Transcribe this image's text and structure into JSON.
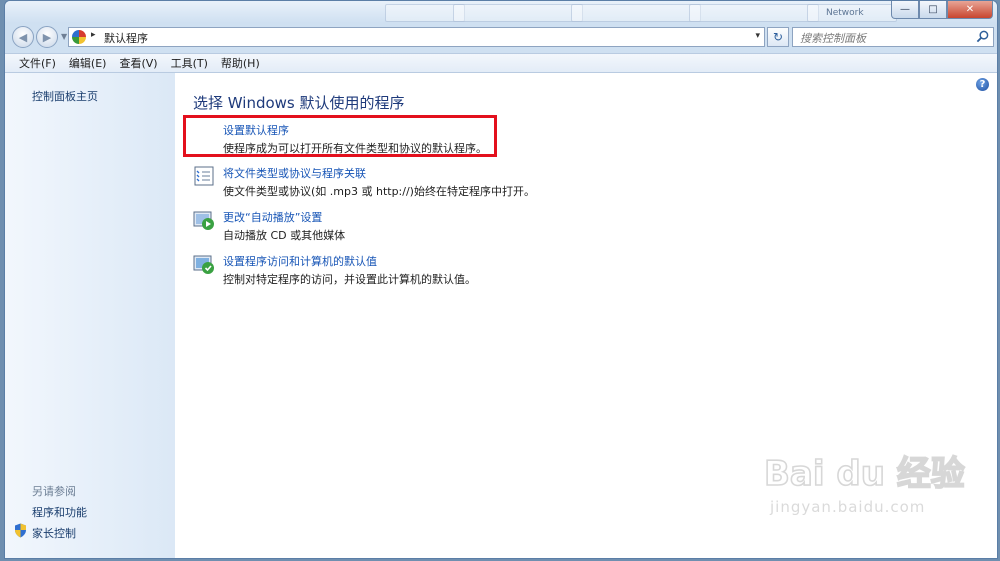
{
  "window": {
    "caption_buttons": {
      "minimize": "—",
      "maximize": "□",
      "close": "✕"
    },
    "background_tabs": [
      "",
      "",
      "",
      "",
      "Network"
    ]
  },
  "address_bar": {
    "path_separator": "▸",
    "path": "默认程序",
    "dropdown_glyph": "▾",
    "refresh_glyph": "↻"
  },
  "search": {
    "placeholder": "搜索控制面板"
  },
  "menu": {
    "items": [
      "文件(F)",
      "编辑(E)",
      "查看(V)",
      "工具(T)",
      "帮助(H)"
    ]
  },
  "sidebar": {
    "home_link": "控制面板主页",
    "see_also_label": "另请参阅",
    "links": [
      "程序和功能",
      "家长控制"
    ]
  },
  "main": {
    "title": "选择 Windows 默认使用的程序",
    "help_glyph": "?",
    "tasks": [
      {
        "link": "设置默认程序",
        "desc": "使程序成为可以打开所有文件类型和协议的默认程序。",
        "icon": "default-programs-icon"
      },
      {
        "link": "将文件类型或协议与程序关联",
        "desc": "使文件类型或协议(如 .mp3 或 http://)始终在特定程序中打开。",
        "icon": "file-association-icon"
      },
      {
        "link": "更改“自动播放”设置",
        "desc": "自动播放 CD 或其他媒体",
        "icon": "autoplay-icon"
      },
      {
        "link": "设置程序访问和计算机的默认值",
        "desc": "控制对特定程序的访问，并设置此计算机的默认值。",
        "icon": "program-access-icon"
      }
    ]
  },
  "watermark": {
    "brand": "Bai du 经验",
    "url": "jingyan.baidu.com"
  },
  "colors": {
    "link": "#1755b6",
    "title": "#1e3a7b",
    "highlight_border": "#e3101d",
    "sidebar": "#dbe8f6"
  }
}
